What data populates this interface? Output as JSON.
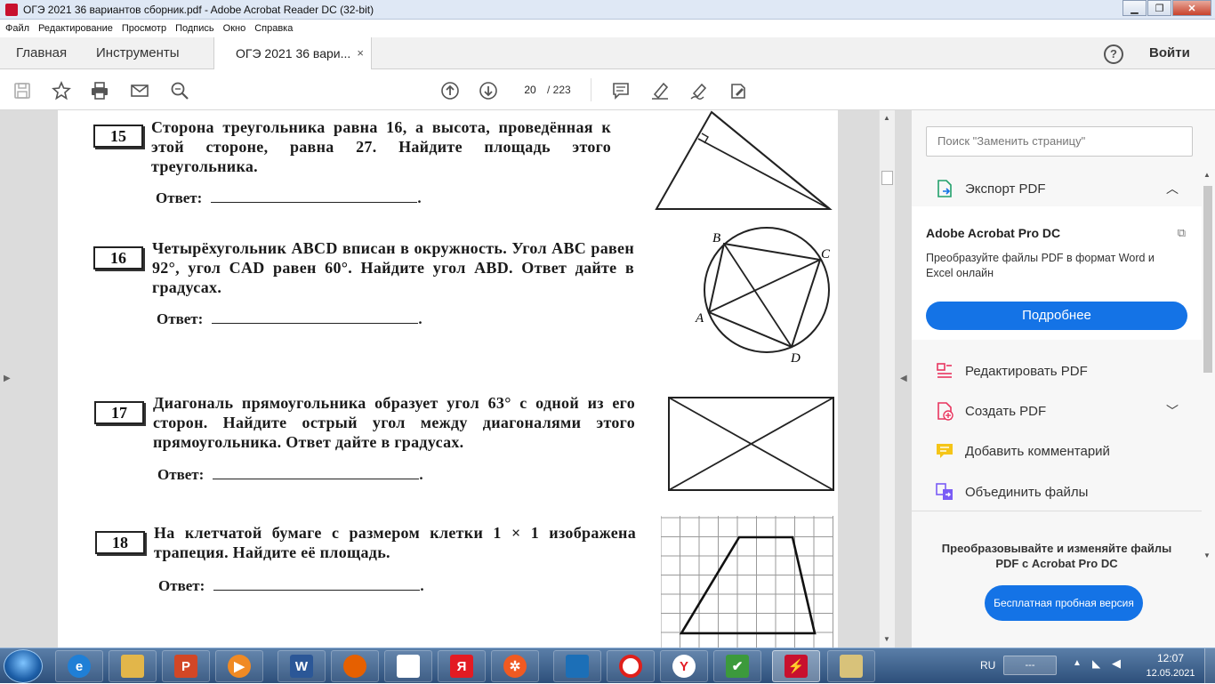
{
  "window": {
    "title": "ОГЭ 2021 36 вариантов сборник.pdf - Adobe Acrobat Reader DC (32-bit)",
    "minimize": "▁",
    "maximize": "❐",
    "close": "✕"
  },
  "menu": [
    "Файл",
    "Редактирование",
    "Просмотр",
    "Подпись",
    "Окно",
    "Справка"
  ],
  "tabs": {
    "home": "Главная",
    "tools": "Инструменты",
    "doc": "ОГЭ 2021 36 вари...",
    "doc_close": "×",
    "help": "?",
    "login": "Войти"
  },
  "toolbar": {
    "page_current": "20",
    "page_total": "/  223"
  },
  "document": {
    "tasks": [
      {
        "num": "15",
        "text": "Сторона треугольника равна 16, а высота, проведённая к этой стороне, равна 27. Найдите площадь этого треугольника.",
        "answer_label": "Ответ:",
        "answer_end": "."
      },
      {
        "num": "16",
        "text": "Четырёхугольник ABCD вписан в окружность. Угол ABC равен 92°, угол CAD равен 60°. Найдите угол ABD. Ответ дайте в градусах.",
        "answer_label": "Ответ:",
        "answer_end": "."
      },
      {
        "num": "17",
        "text": "Диагональ прямоугольника образует угол 63° с одной из его сторон. Найдите острый угол между диагоналями этого прямоугольника. Ответ дайте в градусах.",
        "answer_label": "Ответ:",
        "answer_end": "."
      },
      {
        "num": "18",
        "text": "На клетчатой бумаге с размером клетки 1 × 1 изображена трапеция. Найдите её площадь.",
        "answer_label": "Ответ:",
        "answer_end": "."
      }
    ],
    "figure16_labels": {
      "a": "A",
      "b": "B",
      "c": "C",
      "d": "D"
    }
  },
  "sidebar": {
    "search_placeholder": "Поиск \"Заменить страницу\"",
    "export_label": "Экспорт PDF",
    "promo_title": "Adobe Acrobat Pro DC",
    "promo_desc": "Преобразуйте файлы PDF в формат Word и Excel онлайн",
    "promo_button": "Подробнее",
    "tools": [
      "Редактировать PDF",
      "Создать PDF",
      "Добавить комментарий",
      "Объединить файлы"
    ],
    "footer_text": "Преобразовывайте и изменяйте файлы PDF с Acrobat Pro DC",
    "trial_button": "Бесплатная пробная версия"
  },
  "taskbar": {
    "lang": "RU",
    "keyboard": "---",
    "time": "12:07",
    "date": "12.05.2021"
  },
  "colors": {
    "accent": "#1473e6",
    "acrobat_red": "#c8102e"
  }
}
